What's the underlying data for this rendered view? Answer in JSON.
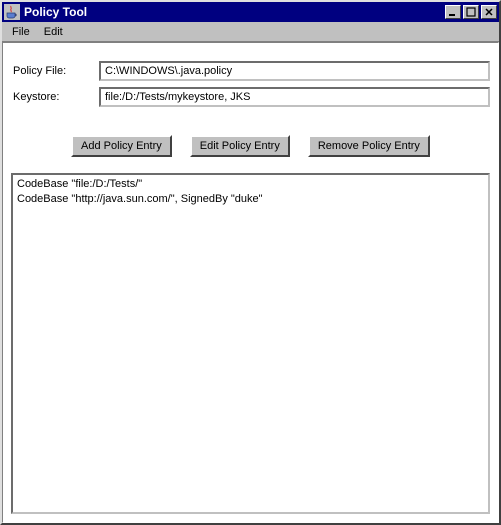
{
  "window": {
    "title": "Policy Tool"
  },
  "menubar": {
    "items": [
      "File",
      "Edit"
    ]
  },
  "form": {
    "policy_file_label": "Policy File:",
    "policy_file_value": "C:\\WINDOWS\\.java.policy",
    "keystore_label": "Keystore:",
    "keystore_value": "file:/D:/Tests/mykeystore, JKS"
  },
  "buttons": {
    "add": "Add Policy Entry",
    "edit": "Edit Policy Entry",
    "remove": "Remove Policy Entry"
  },
  "entries": [
    "CodeBase \"file:/D:/Tests/\"",
    "CodeBase \"http://java.sun.com/\", SignedBy \"duke\""
  ],
  "icons": {
    "minimize": "_",
    "maximize": "□",
    "close": "×"
  }
}
